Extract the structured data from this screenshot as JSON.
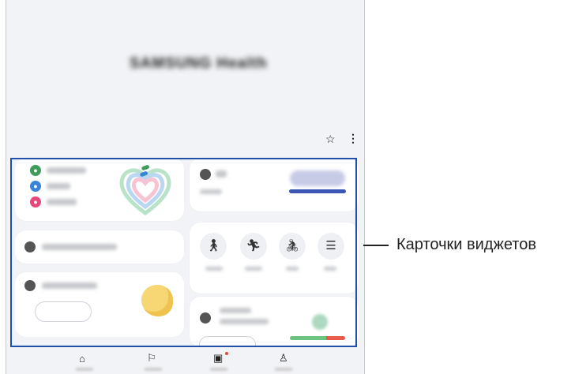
{
  "app": {
    "title": "SAMSUNG Health"
  },
  "header": {
    "star_icon": "☆",
    "more_icon": "⋮"
  },
  "callout": {
    "label": "Карточки виджетов"
  },
  "nav": {
    "items": [
      "home",
      "together",
      "fitness",
      "my-page"
    ]
  },
  "colors": {
    "frame": "#1f4fa6",
    "green": "#3f9c5a",
    "blue": "#3a84d8",
    "pink": "#e8477a"
  }
}
